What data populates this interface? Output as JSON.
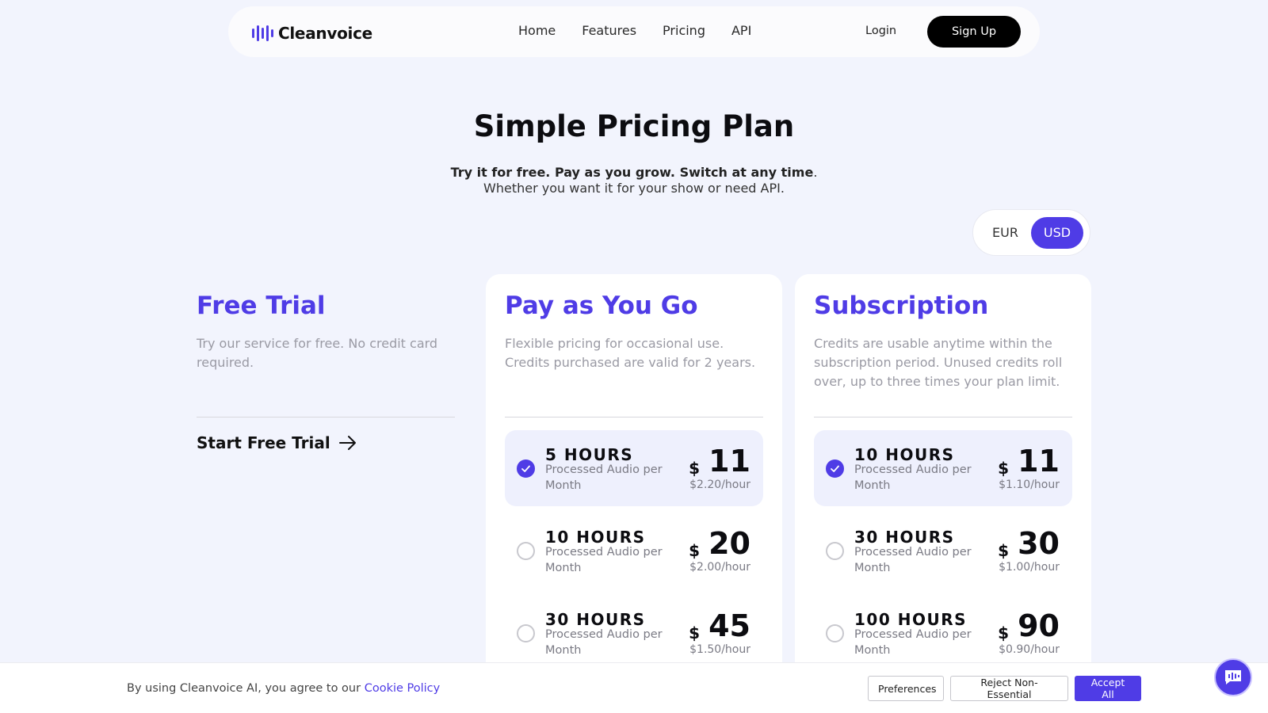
{
  "brand": {
    "name": "Cleanvoice",
    "accent": "#4f3ce6"
  },
  "nav": {
    "links": [
      "Home",
      "Features",
      "Pricing",
      "API"
    ],
    "login": "Login",
    "signup": "Sign Up"
  },
  "hero": {
    "title": "Simple Pricing Plan",
    "tagline_bold": "Try it for free. Pay as you grow. Switch at any time",
    "tagline_end": ".",
    "subline": "Whether you want it for your show or need API."
  },
  "currency": {
    "options": [
      "EUR",
      "USD"
    ],
    "selected": "USD"
  },
  "free_trial": {
    "title": "Free Trial",
    "description": "Try our service for free. No credit card required.",
    "cta": "Start Free Trial"
  },
  "payg": {
    "title": "Pay as You Go",
    "description": "Flexible pricing for occasional use. Credits purchased are valid for 2 years.",
    "options": [
      {
        "hours": "5 HOURS",
        "sub": "Processed Audio per Month",
        "currency": "$",
        "price": "11",
        "rate": "$2.20/hour",
        "selected": true
      },
      {
        "hours": "10 HOURS",
        "sub": "Processed Audio per Month",
        "currency": "$",
        "price": "20",
        "rate": "$2.00/hour",
        "selected": false
      },
      {
        "hours": "30 HOURS",
        "sub": "Processed Audio per Month",
        "currency": "$",
        "price": "45",
        "rate": "$1.50/hour",
        "selected": false
      }
    ]
  },
  "subscription": {
    "title": "Subscription",
    "description": "Credits are usable anytime within the subscription period. Unused credits roll over, up to three times your plan limit.",
    "options": [
      {
        "hours": "10 HOURS",
        "sub": "Processed Audio per Month",
        "currency": "$",
        "price": "11",
        "rate": "$1.10/hour",
        "selected": true
      },
      {
        "hours": "30 HOURS",
        "sub": "Processed Audio per Month",
        "currency": "$",
        "price": "30",
        "rate": "$1.00/hour",
        "selected": false
      },
      {
        "hours": "100 HOURS",
        "sub": "Processed Audio per Month",
        "currency": "$",
        "price": "90",
        "rate": "$0.90/hour",
        "selected": false
      }
    ]
  },
  "cookie": {
    "text": "By using Cleanvoice AI, you agree to our ",
    "link": "Cookie Policy",
    "preferences": "Preferences",
    "reject": "Reject Non-Essential",
    "accept": "Accept All"
  },
  "chat": {
    "icon": "waveform-chat-icon"
  }
}
